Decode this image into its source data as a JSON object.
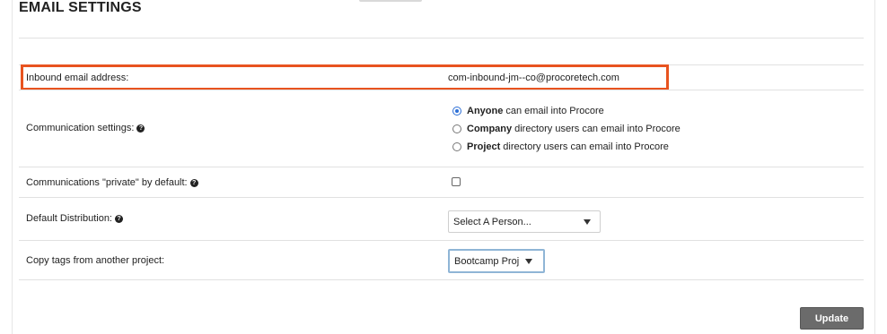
{
  "page": {
    "title": "EMAIL SETTINGS"
  },
  "inbound": {
    "label": "Inbound email address:",
    "value": "com-inbound-jm--co@procoretech.com",
    "highlight_color": "#e8531f"
  },
  "communication": {
    "label": "Communication settings:",
    "options": [
      {
        "bold": "Anyone",
        "text": "can email into Procore",
        "checked": true
      },
      {
        "bold": "Company",
        "text": "directory users can email into Procore",
        "checked": false
      },
      {
        "bold": "Project",
        "text": "directory users can email into Procore",
        "checked": false
      }
    ]
  },
  "private_default": {
    "label": "Communications \"private\" by default:",
    "checked": false
  },
  "distribution": {
    "label": "Default Distribution:",
    "selected": "Select A Person..."
  },
  "copy_tags": {
    "label": "Copy tags from another project:",
    "selected": "Bootcamp Proj"
  },
  "actions": {
    "update_label": "Update"
  },
  "icons": {
    "help": "help-circle-icon",
    "caret": "caret-down-icon"
  },
  "colors": {
    "accent": "#2d6fd6",
    "button": "#6b6b6b",
    "focus_border": "#8fb5d6"
  }
}
